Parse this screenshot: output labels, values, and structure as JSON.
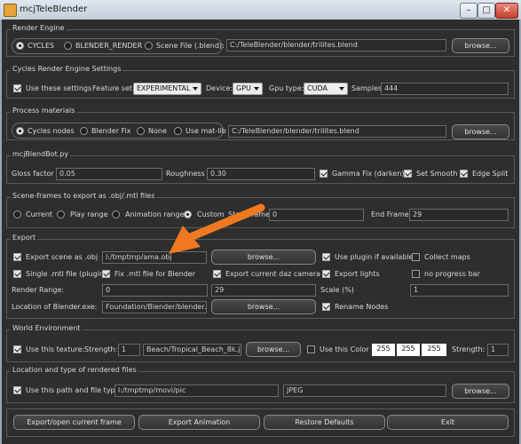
{
  "window": {
    "title": "mcjTeleBlender",
    "minimize": "–",
    "maximize": "□",
    "close": "✕"
  },
  "render_engine": {
    "group_title": "Render Engine",
    "options": [
      "CYCLES",
      "BLENDER_RENDER",
      "Scene File (.blend):"
    ],
    "scene_file_path": "C:/TeleBlender/blender/trilites.blend",
    "browse_label": "browse..."
  },
  "cycles": {
    "group_title": "Cycles Render Engine Settings",
    "use_settings": "Use these settings",
    "feature_set_label": "Feature set:",
    "feature_set_value": "EXPERIMENTAL",
    "device_label": "Device:",
    "device_value": "GPU",
    "gpu_type_label": "Gpu type:",
    "gpu_type_value": "CUDA",
    "samples_label": "Samples",
    "samples_value": "444"
  },
  "process_materials": {
    "group_title": "Process materials",
    "options": [
      "Cycles nodes",
      "Blender Fix",
      "None",
      "Use mat-lib"
    ],
    "matlib_path": "C:/TeleBlender/blender/trilites.blend",
    "browse_label": "browse..."
  },
  "blendbot": {
    "group_title": "mcjBlendBot.py",
    "gloss_label": "Gloss factor",
    "gloss_value": "0.05",
    "roughness_label": "Roughness",
    "roughness_value": "0.30",
    "gamma_fix": "Gamma Fix (darken)",
    "set_smooth": "Set Smooth",
    "edge_split": "Edge Split"
  },
  "scene_frames": {
    "group_title": "Scene-frames to export as .obj/.mtl files",
    "options": [
      "Current",
      "Play range",
      "Animation range",
      "Custom"
    ],
    "start_label": "Start Frame",
    "start_value": "0",
    "end_label": "End Frame",
    "end_value": "29"
  },
  "export": {
    "group_title": "Export",
    "export_obj": "Export scene as .obj",
    "obj_path": "l:/tmptmp/ama.obj",
    "browse_label": "browse...",
    "use_plugin": "Use plugin if available",
    "collect_maps": "Collect maps",
    "single_mtl": "Single .mtl file (plugin)",
    "fix_mtl": "Fix .mtl file for Blender",
    "export_camera": "Export current daz camera",
    "export_lights": "Export lights",
    "no_progress": "no progress bar",
    "render_range_label": "Render Range:",
    "range_start": "0",
    "range_end": "29",
    "scale_label": "Scale (%)",
    "scale_value": "1",
    "blender_exe_label": "Location of Blender.exe:",
    "blender_exe_path": "Foundation/Blender/blender.exe",
    "browse2_label": "browse...",
    "rename_nodes": "Rename Nodes"
  },
  "world": {
    "group_title": "World Environment",
    "use_texture": "Use this texture:",
    "strength_label": "Strength:",
    "strength_value": "1",
    "texture_path": "Beach/Tropical_Beach_8k.jpg",
    "browse_label": "browse...",
    "use_color": "Use this Color",
    "color_r": "255",
    "color_g": "255",
    "color_b": "255",
    "strength2_label": "Strength:",
    "strength2_value": "1"
  },
  "output": {
    "group_title": "Location and type of rendered files",
    "use_path": "Use this path and file type",
    "path_value": "l:/tmptmp/movi/pic",
    "file_type": "JPEG",
    "browse_label": "browse..."
  },
  "actions": {
    "export_open": "Export/open current frame",
    "export_animation": "Export Animation",
    "restore_defaults": "Restore Defaults",
    "exit": "Exit"
  },
  "colors": {
    "annotation_arrow": "#f07820"
  }
}
